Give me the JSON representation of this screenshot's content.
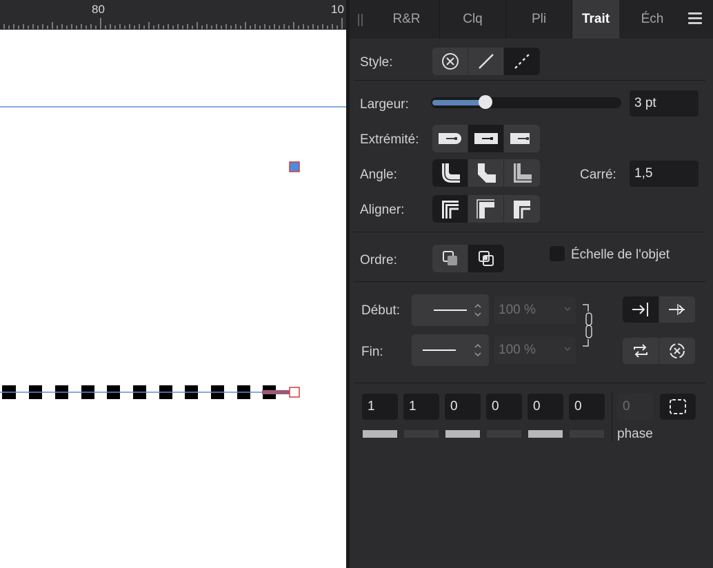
{
  "ruler": {
    "label_1": "80",
    "label_2": "10"
  },
  "tabs": [
    {
      "label": "R&R"
    },
    {
      "label": "Clq"
    },
    {
      "label": "Pli"
    },
    {
      "label": "Trait"
    },
    {
      "label": "Éch"
    }
  ],
  "stroke": {
    "style_label": "Style:",
    "width_label": "Largeur:",
    "width_value": "3 pt",
    "width_level": 0.27,
    "cap_label": "Extrémité:",
    "join_label": "Angle:",
    "miter_label": "Carré:",
    "miter_value": "1,5",
    "align_label": "Aligner:",
    "order_label": "Ordre:",
    "scale_label": "Échelle de l'objet",
    "start_label": "Début:",
    "end_label": "Fin:",
    "start_pct": "100 %",
    "end_pct": "100 %",
    "dash_values": [
      "1",
      "1",
      "0",
      "0",
      "0",
      "0"
    ],
    "phase_value": "0",
    "phase_label": "phase"
  },
  "colors": {
    "accent": "#5b8fd4",
    "handle_red": "#d43a3a",
    "panel_bg": "#2c2c2e"
  }
}
